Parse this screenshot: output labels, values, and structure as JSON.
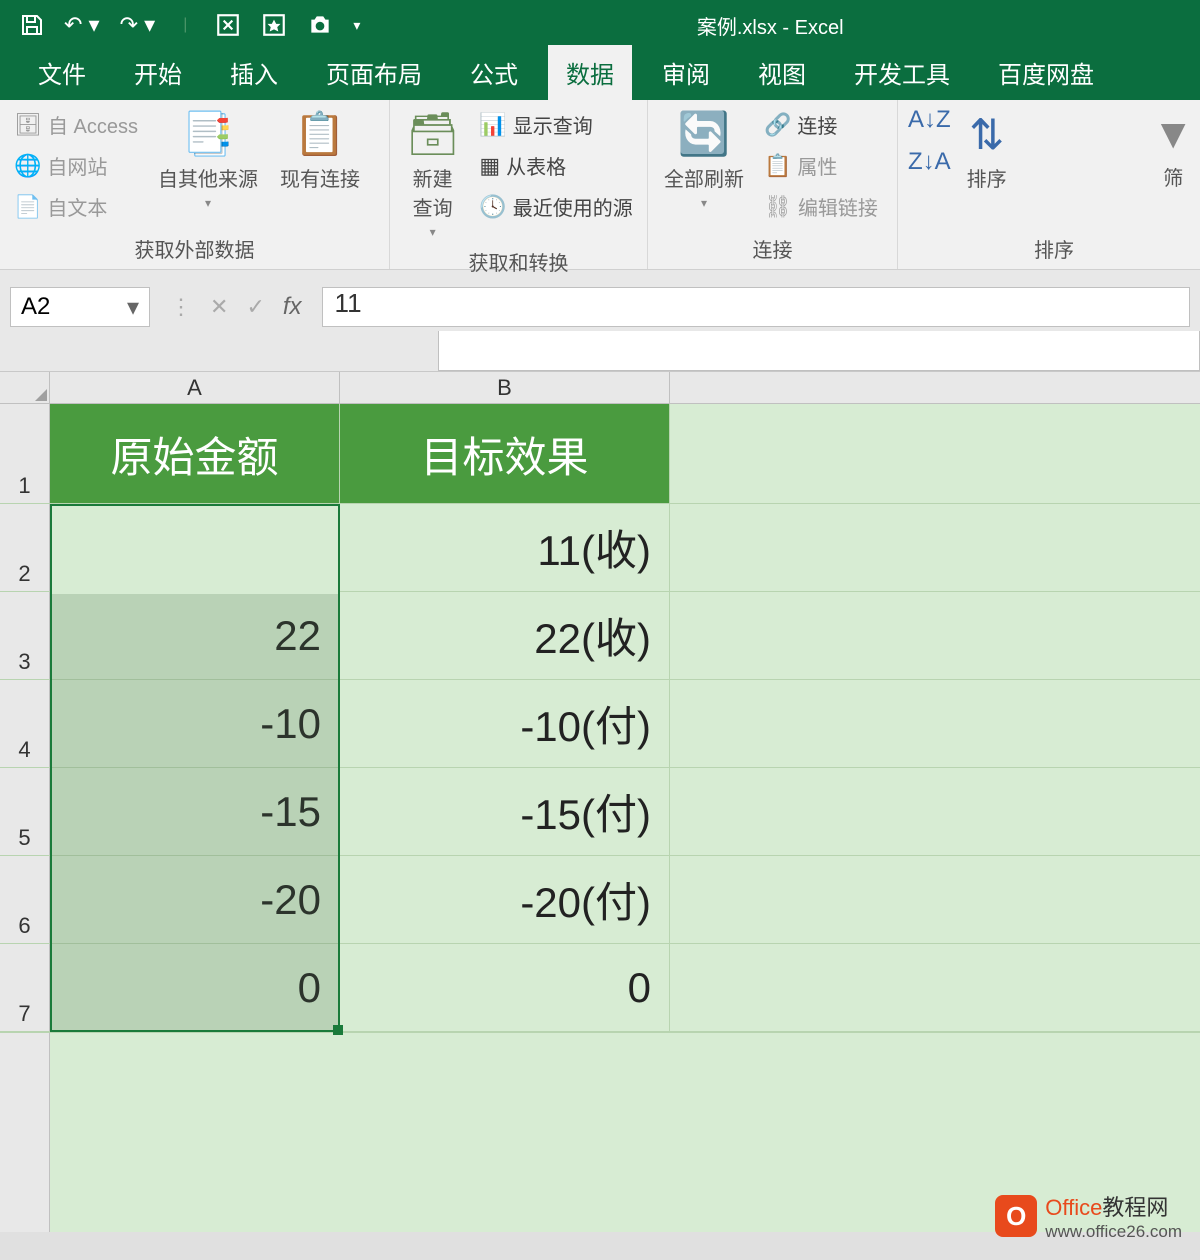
{
  "window": {
    "title": "案例.xlsx - Excel"
  },
  "qat": {
    "save": "save",
    "undo": "undo",
    "redo": "redo"
  },
  "tabs": [
    "文件",
    "开始",
    "插入",
    "页面布局",
    "公式",
    "数据",
    "审阅",
    "视图",
    "开发工具",
    "百度网盘"
  ],
  "active_tab": "数据",
  "ribbon": {
    "group1": {
      "label": "获取外部数据",
      "access": "自 Access",
      "web": "自网站",
      "text": "自文本",
      "other": "自其他来源",
      "existing": "现有连接"
    },
    "group2": {
      "label": "获取和转换",
      "newquery": "新建\n查询",
      "showquery": "显示查询",
      "fromtable": "从表格",
      "recent": "最近使用的源"
    },
    "group3": {
      "label": "连接",
      "refreshall": "全部刷新",
      "connections": "连接",
      "properties": "属性",
      "editlinks": "编辑链接"
    },
    "group4": {
      "label": "排序",
      "sort": "排序",
      "filter": "筛"
    }
  },
  "name_box": "A2",
  "formula_value": "11",
  "columns": [
    "A",
    "B"
  ],
  "headers": {
    "a": "原始金额",
    "b": "目标效果"
  },
  "rows": [
    {
      "n": "2",
      "a": "11",
      "b": "11(收)"
    },
    {
      "n": "3",
      "a": "22",
      "b": "22(收)"
    },
    {
      "n": "4",
      "a": "-10",
      "b": "-10(付)"
    },
    {
      "n": "5",
      "a": "-15",
      "b": "-15(付)"
    },
    {
      "n": "6",
      "a": "-20",
      "b": "-20(付)"
    },
    {
      "n": "7",
      "a": "0",
      "b": "0"
    }
  ],
  "watermark": {
    "brand": "Office",
    "suffix": "教程网",
    "url": "www.office26.com"
  }
}
